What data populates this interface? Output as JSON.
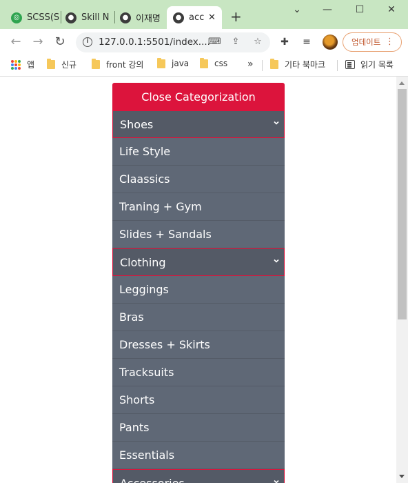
{
  "browser": {
    "tabs": [
      {
        "title": "SCSS(S",
        "favicon": "scss-icon",
        "color": "#2ea44f"
      },
      {
        "title": "Skill Ne",
        "favicon": "globe-icon",
        "color": "#3c3c3c"
      },
      {
        "title": "이재명",
        "favicon": "globe-icon",
        "color": "#3c3c3c"
      },
      {
        "title": "acc",
        "favicon": "globe-icon",
        "color": "#3c3c3c",
        "active": true
      }
    ],
    "url": "127.0.0.1:5501/index....",
    "update_label": "업데이트",
    "bookmarks": [
      {
        "label": "앱",
        "icon": "apps-icon"
      },
      {
        "label": "신규",
        "icon": "folder-icon"
      },
      {
        "label": "front 강의",
        "icon": "folder-icon"
      },
      {
        "label": "java",
        "icon": "folder-icon"
      },
      {
        "label": "css",
        "icon": "folder-icon"
      },
      {
        "label": "기타 북마크",
        "icon": "folder-icon"
      },
      {
        "label": "읽기 목록",
        "icon": "reading-list-icon"
      }
    ],
    "overflow_glyph": "»"
  },
  "accordion": {
    "header": "Close Categorization",
    "accent_color": "#dc143c",
    "sections": [
      {
        "label": "Shoes",
        "items": [
          "Life Style",
          "Claassics",
          "Traning + Gym",
          "Slides + Sandals"
        ]
      },
      {
        "label": "Clothing",
        "items": [
          "Leggings",
          "Bras",
          "Dresses + Skirts",
          "Tracksuits",
          "Shorts",
          "Pants",
          "Essentials"
        ]
      },
      {
        "label": "Accessories",
        "items": []
      }
    ]
  }
}
